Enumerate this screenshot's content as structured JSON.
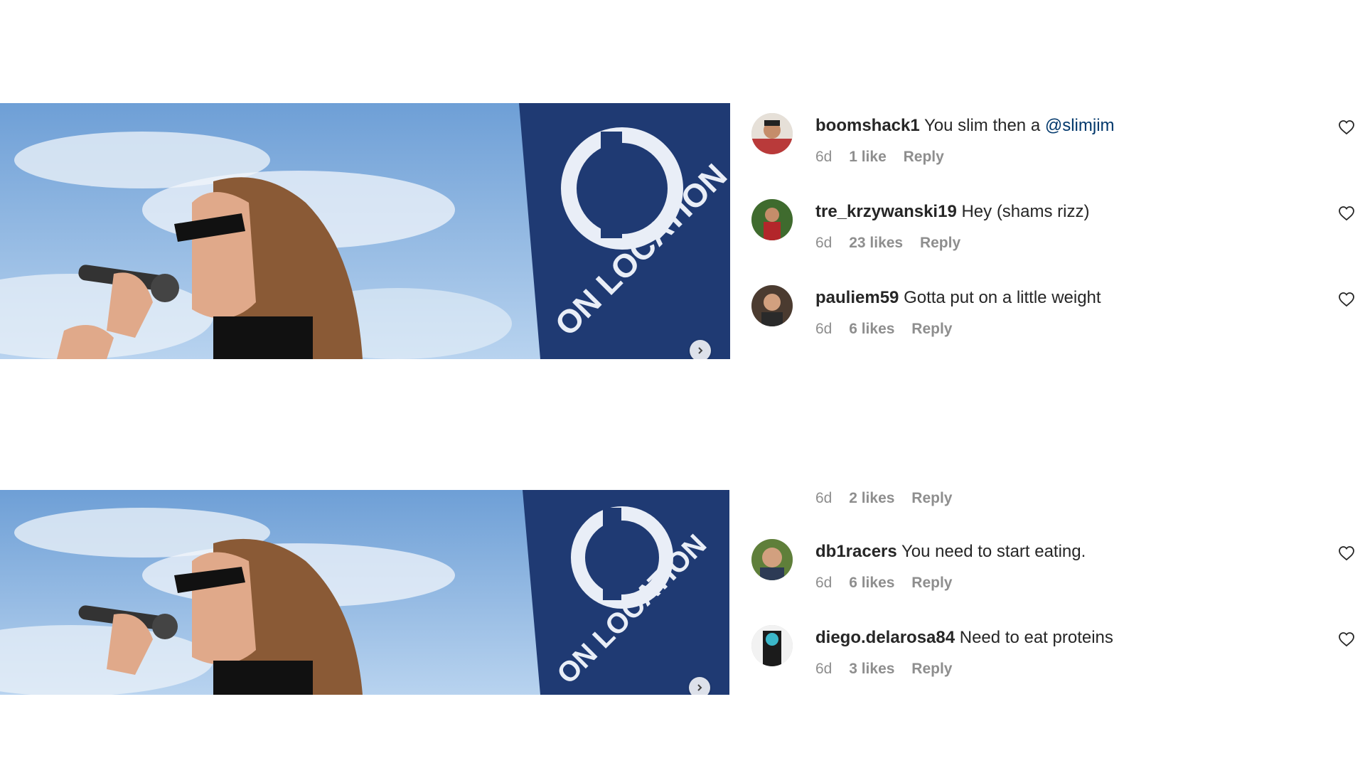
{
  "post_image": {
    "sign_text": "ON LOCATION",
    "colors": {
      "sky": "#9fc3e8",
      "sign": "#1f3a73",
      "hair": "#8a5a36",
      "skin": "#e0a98a"
    }
  },
  "comments_top": [
    {
      "username": "boomshack1",
      "text": "You slim then a ",
      "mention": "@slimjim",
      "time": "6d",
      "likes": "1 like",
      "reply": "Reply",
      "avatar_color": "#b93a3a"
    },
    {
      "username": "tre_krzywanski19",
      "text": "Hey (shams rizz)",
      "mention": "",
      "time": "6d",
      "likes": "23 likes",
      "reply": "Reply",
      "avatar_color": "#3f6b2e"
    },
    {
      "username": "pauliem59",
      "text": "Gotta put on a little weight",
      "mention": "",
      "time": "6d",
      "likes": "6 likes",
      "reply": "Reply",
      "avatar_color": "#4b3b30"
    }
  ],
  "partial_meta": {
    "time": "6d",
    "likes": "2 likes",
    "reply": "Reply"
  },
  "comments_bottom": [
    {
      "username": "db1racers",
      "text": "You need to start eating.",
      "mention": "",
      "time": "6d",
      "likes": "6 likes",
      "reply": "Reply",
      "avatar_color": "#5f7f3a"
    },
    {
      "username": "diego.delarosa84",
      "text": "Need to eat proteins",
      "mention": "",
      "time": "6d",
      "likes": "3 likes",
      "reply": "Reply",
      "avatar_color": "#1b1b1b"
    }
  ]
}
